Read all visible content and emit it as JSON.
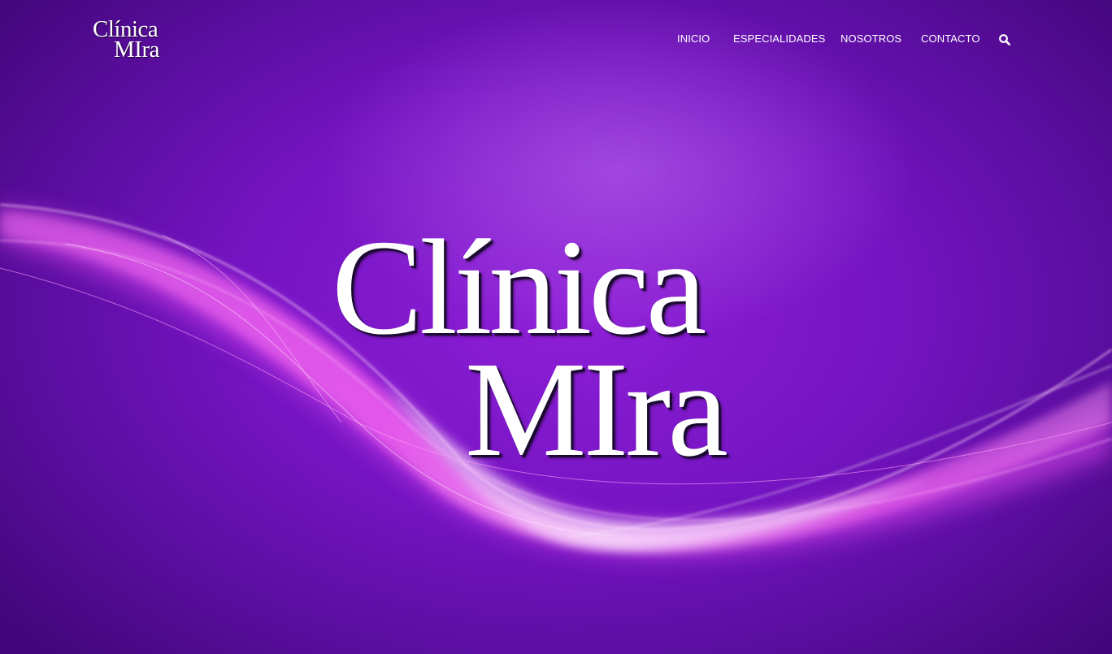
{
  "brand": {
    "logo_line1": "Clínica",
    "logo_line2": "MIra"
  },
  "nav": {
    "items": [
      {
        "label": "INICIO"
      },
      {
        "label": "ESPECIALIDADES"
      },
      {
        "label": "NOSOTROS"
      },
      {
        "label": "CONTACTO"
      }
    ],
    "search_icon": "search-icon"
  },
  "hero": {
    "title_line1": "Clínica",
    "title_line2": "MIra"
  },
  "colors": {
    "background": "#7414c2",
    "wave": "#ff5cf0",
    "text": "#ffffff"
  }
}
